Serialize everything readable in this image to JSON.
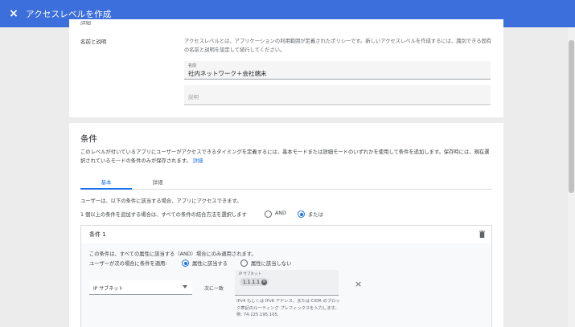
{
  "topbar": {
    "close_icon": "×",
    "title": "アクセスレベルを作成",
    "color": "#3c6fdc"
  },
  "details": {
    "section_label": "詳細",
    "row_label": "名前と説明",
    "description": "アクセスレベルとは、アプリケーションの利用範囲が定義されたポリシーです。新しいアクセスレベルを作成するには、識別できる固有の名前と説明を設定して続行してください。",
    "name_field": {
      "label": "名前",
      "value": "社内ネットワーク＋会社端末"
    },
    "description_field": {
      "placeholder": "説明"
    }
  },
  "conditions": {
    "title": "条件",
    "description": "このレベルが付いているアプリにユーザーがアクセスできるタイミングを定義するには、基本モードまたは詳細モードのいずれかを使用して条件を追加します。保存時には、現在選択されているモードの条件のみが保存されます。",
    "details_link": "詳細",
    "tabs": [
      {
        "label": "基本",
        "active": true
      },
      {
        "label": "詳細",
        "active": false
      }
    ],
    "access_text": "ユーザーは、以下の条件に該当する場合、アプリにアクセスできます。",
    "combine_text": "1 個以上の条件を追加する場合は、すべての条件の結合方法を選択します",
    "combine_options": [
      {
        "label": "AND",
        "selected": false
      },
      {
        "label": "または",
        "selected": true
      }
    ],
    "condition1": {
      "title": "条件 1",
      "trash_icon": "trash-icon",
      "and_note": "この条件は、すべての属性に該当する（AND）場合にのみ適用されます。",
      "apply_text": "ユーザーが次の場合に条件を適用:",
      "apply_options": [
        {
          "label": "属性に該当する",
          "selected": true
        },
        {
          "label": "属性に該当しない",
          "selected": false
        }
      ],
      "attribute_select": "IP サブネット",
      "match_text": "次に一致",
      "ip_field": {
        "label": "IP サブネット",
        "chip": "1.1.1.1"
      },
      "hint": "IPv4 もしくは IPv6 アドレス、または CIDR のブロック表記のルーティング プレフィックスを入力します。例: 74.125.195.105,",
      "remove_icon": "×"
    }
  }
}
